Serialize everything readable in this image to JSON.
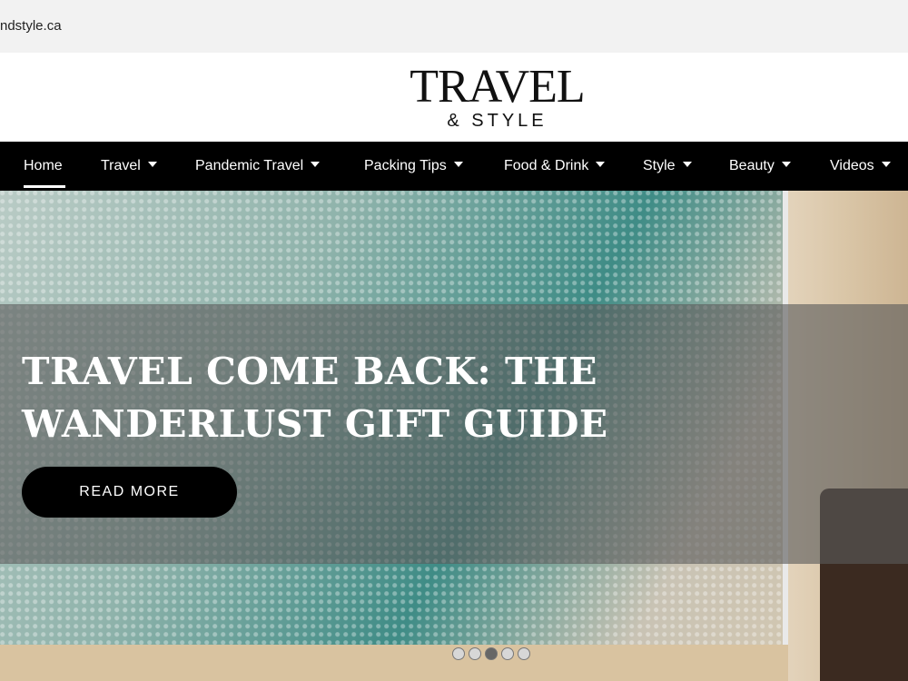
{
  "browser": {
    "url": "ndstyle.ca"
  },
  "logo": {
    "line1": "TRAVEL",
    "line2": "& STYLE"
  },
  "nav": {
    "items": [
      {
        "label": "Home",
        "has_dropdown": false,
        "active": true
      },
      {
        "label": "Travel",
        "has_dropdown": true
      },
      {
        "label": "Pandemic Travel",
        "has_dropdown": true
      },
      {
        "label": "Packing Tips",
        "has_dropdown": true
      },
      {
        "label": "Food & Drink",
        "has_dropdown": true
      },
      {
        "label": "Style",
        "has_dropdown": true
      },
      {
        "label": "Beauty",
        "has_dropdown": true
      },
      {
        "label": "Videos",
        "has_dropdown": true
      }
    ]
  },
  "hero": {
    "headline_line1": "TRAVEL COME BACK: THE",
    "headline_line2": "WANDERLUST GIFT GUIDE",
    "button_label": "READ MORE",
    "slide_count": 5,
    "active_slide": 3
  },
  "colors": {
    "nav_bg": "#000000",
    "accent": "#ffffff"
  },
  "icons": {
    "dropdown": "caret-down-icon"
  }
}
